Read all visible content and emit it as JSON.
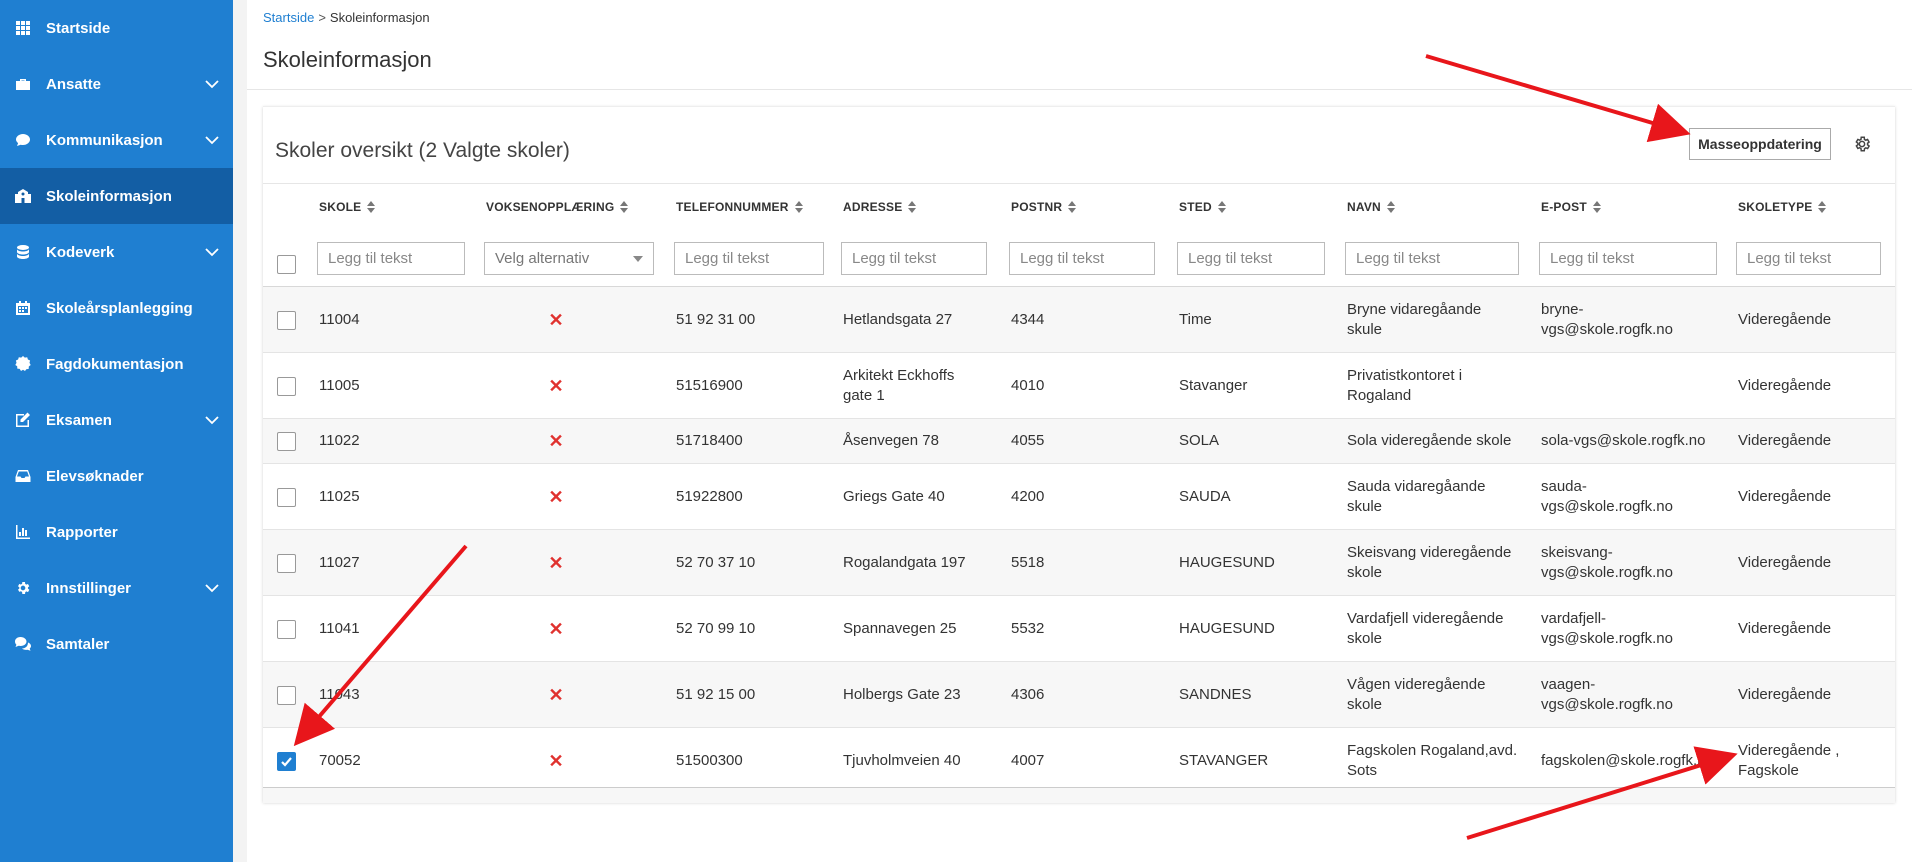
{
  "sidebar": {
    "items": [
      {
        "label": "Startside",
        "icon": "grid-icon",
        "has_chevron": false,
        "active": false
      },
      {
        "label": "Ansatte",
        "icon": "briefcase-icon",
        "has_chevron": true,
        "active": false
      },
      {
        "label": "Kommunikasjon",
        "icon": "chat-bubble-icon",
        "has_chevron": true,
        "active": false
      },
      {
        "label": "Skoleinformasjon",
        "icon": "school-icon",
        "has_chevron": false,
        "active": true
      },
      {
        "label": "Kodeverk",
        "icon": "database-icon",
        "has_chevron": true,
        "active": false
      },
      {
        "label": "Skoleårsplanlegging",
        "icon": "calendar-icon",
        "has_chevron": false,
        "active": false
      },
      {
        "label": "Fagdokumentasjon",
        "icon": "badge-icon",
        "has_chevron": false,
        "active": false
      },
      {
        "label": "Eksamen",
        "icon": "edit-icon",
        "has_chevron": true,
        "active": false
      },
      {
        "label": "Elevsøknader",
        "icon": "inbox-icon",
        "has_chevron": false,
        "active": false
      },
      {
        "label": "Rapporter",
        "icon": "bar-chart-icon",
        "has_chevron": false,
        "active": false
      },
      {
        "label": "Innstillinger",
        "icon": "gear-icon",
        "has_chevron": true,
        "active": false
      },
      {
        "label": "Samtaler",
        "icon": "chat-icon",
        "has_chevron": false,
        "active": false
      }
    ]
  },
  "breadcrumb": {
    "home": "Startside",
    "separator": ">",
    "current": "Skoleinformasjon"
  },
  "page_title": "Skoleinformasjon",
  "card": {
    "title": "Skoler oversikt (2 Valgte skoler)",
    "mass_update_label": "Masseoppdatering"
  },
  "table": {
    "columns": [
      "SKOLE",
      "VOKSENOPPLÆRING",
      "TELEFONNUMMER",
      "ADRESSE",
      "POSTNR",
      "STED",
      "NAVN",
      "E-POST",
      "SKOLETYPE"
    ],
    "filters": {
      "text_placeholder": "Legg til tekst",
      "select_placeholder": "Velg alternativ"
    },
    "rows": [
      {
        "checked": false,
        "skole": "11004",
        "voksen": "✕",
        "telefon": "51 92 31 00",
        "adresse": [
          "Hetlandsgata 27"
        ],
        "postnr": "4344",
        "sted": "Time",
        "navn": [
          "Bryne vidaregåande",
          "skule"
        ],
        "epost": [
          "bryne-",
          "vgs@skole.rogfk.no"
        ],
        "skoletype": [
          "Videregående"
        ]
      },
      {
        "checked": false,
        "skole": "11005",
        "voksen": "✕",
        "telefon": "51516900",
        "adresse": [
          "Arkitekt Eckhoffs",
          "gate 1"
        ],
        "postnr": "4010",
        "sted": "Stavanger",
        "navn": [
          "Privatistkontoret i",
          "Rogaland"
        ],
        "epost": [
          ""
        ],
        "skoletype": [
          "Videregående"
        ]
      },
      {
        "checked": false,
        "skole": "11022",
        "voksen": "✕",
        "telefon": "51718400",
        "adresse": [
          "Åsenvegen 78"
        ],
        "postnr": "4055",
        "sted": "SOLA",
        "navn": [
          "Sola videregående skole"
        ],
        "epost": [
          "sola-vgs@skole.rogfk.no"
        ],
        "skoletype": [
          "Videregående"
        ]
      },
      {
        "checked": false,
        "skole": "11025",
        "voksen": "✕",
        "telefon": "51922800",
        "adresse": [
          "Griegs Gate 40"
        ],
        "postnr": "4200",
        "sted": "SAUDA",
        "navn": [
          "Sauda vidaregåande",
          "skule"
        ],
        "epost": [
          "sauda-",
          "vgs@skole.rogfk.no"
        ],
        "skoletype": [
          "Videregående"
        ]
      },
      {
        "checked": false,
        "skole": "11027",
        "voksen": "✕",
        "telefon": "52 70 37 10",
        "adresse": [
          "Rogalandgata 197"
        ],
        "postnr": "5518",
        "sted": "HAUGESUND",
        "navn": [
          "Skeisvang videregående",
          "skole"
        ],
        "epost": [
          "skeisvang-",
          "vgs@skole.rogfk.no"
        ],
        "skoletype": [
          "Videregående"
        ]
      },
      {
        "checked": false,
        "skole": "11041",
        "voksen": "✕",
        "telefon": "52 70 99 10",
        "adresse": [
          "Spannavegen 25"
        ],
        "postnr": "5532",
        "sted": "HAUGESUND",
        "navn": [
          "Vardafjell videregående",
          "skole"
        ],
        "epost": [
          "vardafjell-",
          "vgs@skole.rogfk.no"
        ],
        "skoletype": [
          "Videregående"
        ]
      },
      {
        "checked": false,
        "skole": "11043",
        "voksen": "✕",
        "telefon": "51 92 15 00",
        "adresse": [
          "Holbergs Gate 23"
        ],
        "postnr": "4306",
        "sted": "SANDNES",
        "navn": [
          "Vågen videregående",
          "skole"
        ],
        "epost": [
          "vaagen-",
          "vgs@skole.rogfk.no"
        ],
        "skoletype": [
          "Videregående"
        ]
      },
      {
        "checked": true,
        "skole": "70052",
        "voksen": "✕",
        "telefon": "51500300",
        "adresse": [
          "Tjuvholmveien 40"
        ],
        "postnr": "4007",
        "sted": "STAVANGER",
        "navn": [
          "Fagskolen Rogaland,avd.",
          "Sots"
        ],
        "epost": [
          "fagskolen@skole.rogfk.no"
        ],
        "skoletype": [
          "Videregående ,",
          "Fagskole"
        ]
      }
    ]
  },
  "colors": {
    "sidebar": "#1f7fd1",
    "sidebar_active": "#135ea4",
    "accent": "#1f7fd1",
    "x_mark": "#e0322f",
    "annotation_arrow": "#e8161b"
  }
}
